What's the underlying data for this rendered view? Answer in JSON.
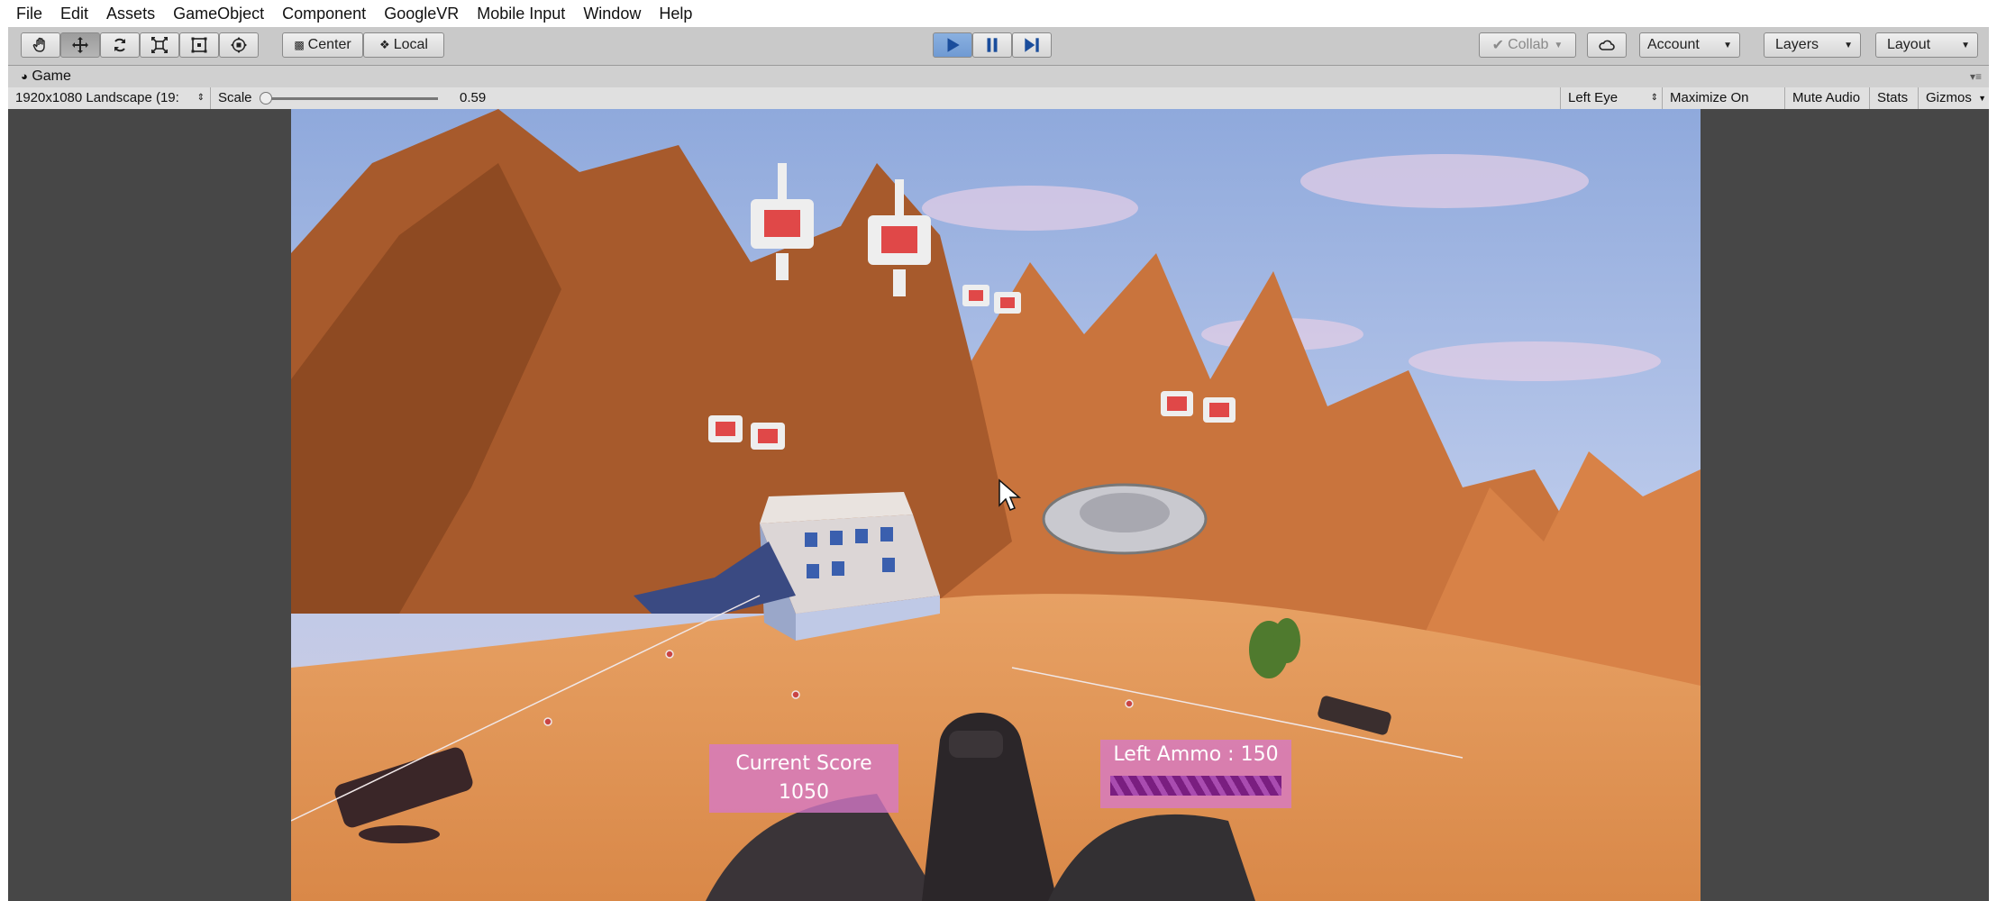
{
  "menu": [
    "File",
    "Edit",
    "Assets",
    "GameObject",
    "Component",
    "GoogleVR",
    "Mobile Input",
    "Window",
    "Help"
  ],
  "toolbar": {
    "pivot_label": "Center",
    "space_label": "Local",
    "collab_label": "Collab",
    "account_label": "Account",
    "layers_label": "Layers",
    "layout_label": "Layout"
  },
  "game_tab": {
    "title": "Game"
  },
  "game_options": {
    "resolution": "1920x1080 Landscape (19:",
    "scale_label": "Scale",
    "scale_value": "0.59",
    "scale_fraction": 0.02,
    "eye": "Left Eye",
    "maximize": "Maximize On Play",
    "mute": "Mute Audio",
    "stats": "Stats",
    "gizmos": "Gizmos"
  },
  "hud": {
    "score_label": "Current Score",
    "score_value": "1050",
    "ammo_label": "Left Ammo : 150"
  },
  "colors": {
    "play_active": "#6f9ad3",
    "hud_panel": "#d678c8",
    "sky": "#9fb6e0",
    "ground": "#e89b55"
  }
}
